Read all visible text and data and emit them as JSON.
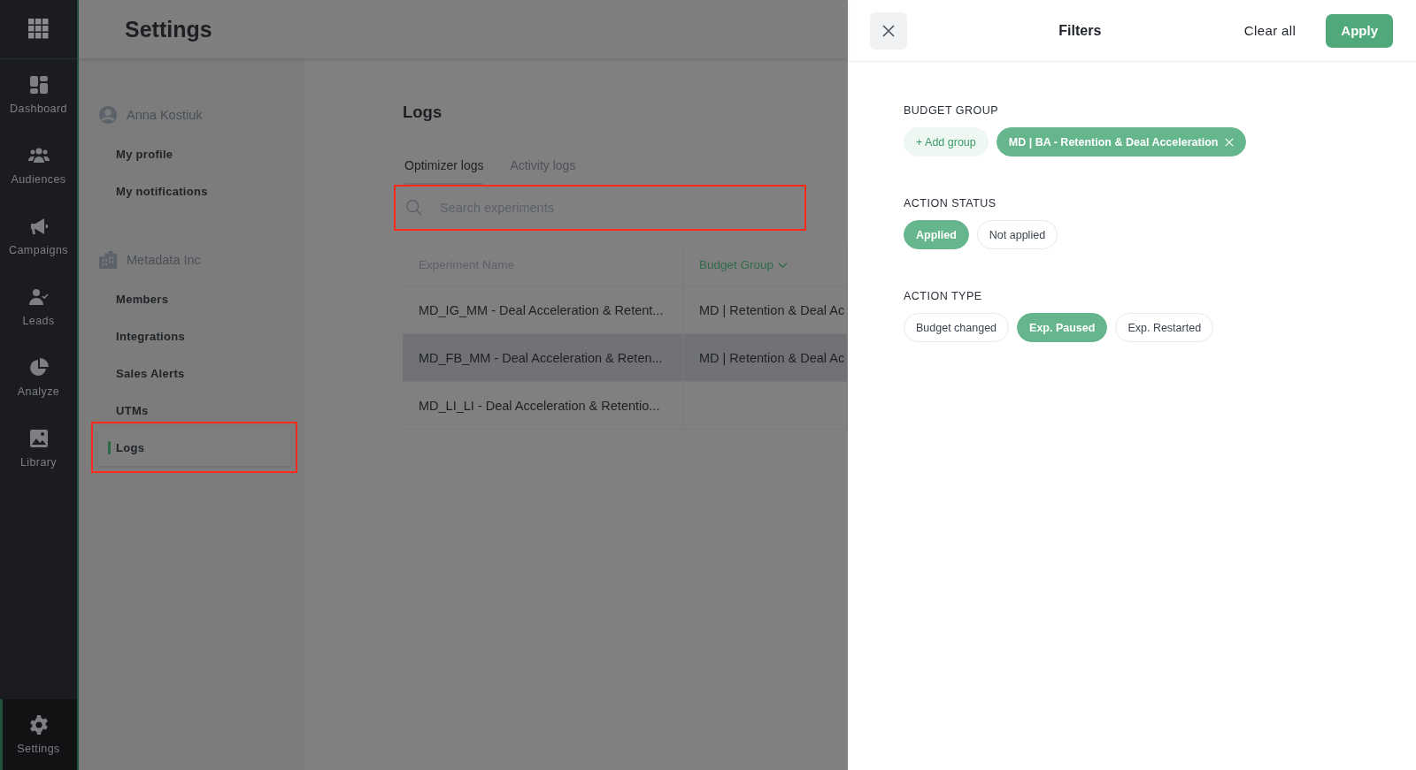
{
  "nav": {
    "items": [
      {
        "label": "Dashboard",
        "selected": false
      },
      {
        "label": "Audiences",
        "selected": false
      },
      {
        "label": "Campaigns",
        "selected": false
      },
      {
        "label": "Leads",
        "selected": false
      },
      {
        "label": "Analyze",
        "selected": false
      },
      {
        "label": "Library",
        "selected": false
      }
    ],
    "bottom": {
      "label": "Settings",
      "selected": true
    }
  },
  "header": {
    "title": "Settings"
  },
  "settings_menu": {
    "sections": [
      {
        "kind": "user",
        "title": "Anna Kostiuk",
        "items": [
          {
            "label": "My profile",
            "selected": false,
            "highlighted": false
          },
          {
            "label": "My notifications",
            "selected": false,
            "highlighted": false
          }
        ]
      },
      {
        "kind": "org",
        "title": "Metadata Inc",
        "items": [
          {
            "label": "Members",
            "selected": false,
            "highlighted": false
          },
          {
            "label": "Integrations",
            "selected": false,
            "highlighted": false
          },
          {
            "label": "Sales Alerts",
            "selected": false,
            "highlighted": false
          },
          {
            "label": "UTMs",
            "selected": false,
            "highlighted": false
          },
          {
            "label": "Logs",
            "selected": true,
            "highlighted": true
          }
        ]
      }
    ]
  },
  "logs": {
    "title": "Logs",
    "tabs": [
      {
        "label": "Optimizer logs",
        "selected": true
      },
      {
        "label": "Activity logs",
        "selected": false
      }
    ],
    "search": {
      "placeholder": "Search experiments",
      "highlighted": true
    },
    "table": {
      "columns": [
        {
          "label": "Experiment Name",
          "sorted": false
        },
        {
          "label": "Budget Group",
          "sorted": true
        }
      ],
      "rows": [
        {
          "cells": [
            "MD_IG_MM - Deal Acceleration & Retent...",
            "MD | Retention & Deal Ac"
          ],
          "hovered": false
        },
        {
          "cells": [
            "MD_FB_MM - Deal Acceleration & Reten...",
            "MD | Retention & Deal Ac"
          ],
          "hovered": true
        },
        {
          "cells": [
            "MD_LI_LI - Deal Acceleration & Retentio..."
          ],
          "hovered": false
        }
      ]
    }
  },
  "filters": {
    "title": "Filters",
    "clear_all": "Clear all",
    "apply": "Apply",
    "groups": [
      {
        "label": "BUDGET GROUP",
        "chips": [
          {
            "kind": "add",
            "label": "+ Add group",
            "selected": false
          },
          {
            "kind": "tag",
            "label": "MD | BA - Retention & Deal Acceleration",
            "selected": true
          }
        ]
      },
      {
        "label": "ACTION STATUS",
        "chips": [
          {
            "kind": "option",
            "label": "Applied",
            "selected": true
          },
          {
            "kind": "option",
            "label": "Not applied",
            "selected": false
          }
        ]
      },
      {
        "label": "ACTION TYPE",
        "chips": [
          {
            "kind": "option",
            "label": "Budget changed",
            "selected": false
          },
          {
            "kind": "option",
            "label": "Exp. Paused",
            "selected": true
          },
          {
            "kind": "option",
            "label": "Exp. Restarted",
            "selected": false
          }
        ]
      }
    ]
  }
}
